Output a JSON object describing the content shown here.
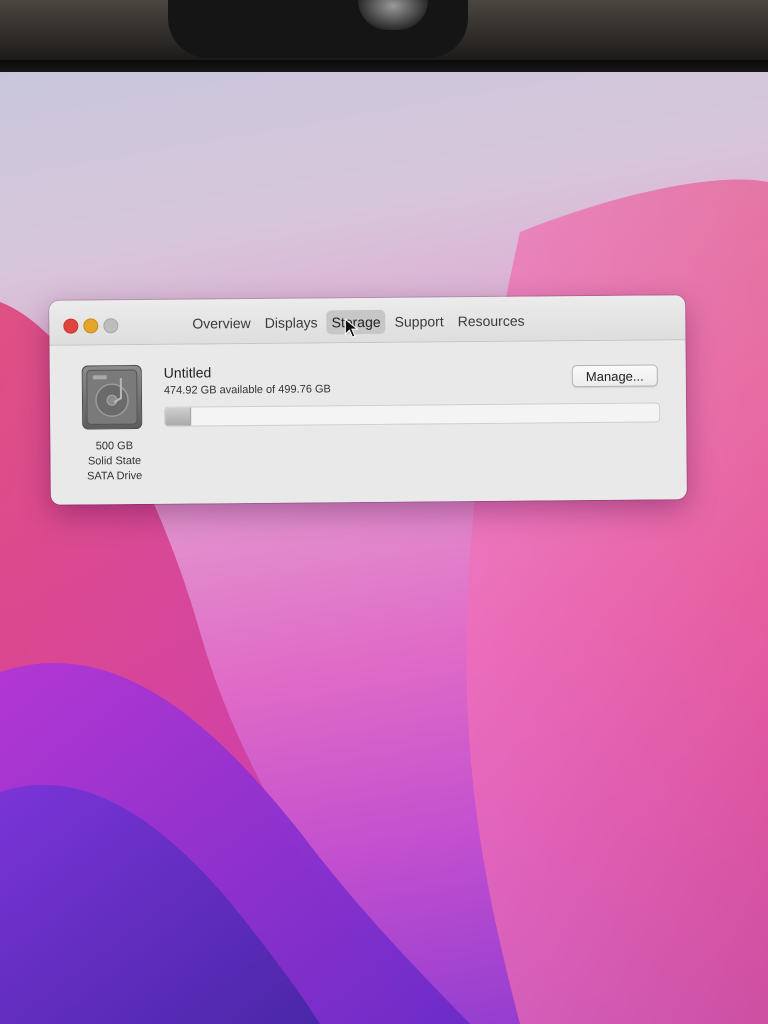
{
  "window": {
    "tabs": [
      {
        "label": "Overview",
        "active": false
      },
      {
        "label": "Displays",
        "active": false
      },
      {
        "label": "Storage",
        "active": true
      },
      {
        "label": "Support",
        "active": false
      },
      {
        "label": "Resources",
        "active": false
      }
    ]
  },
  "storage": {
    "volume_name": "Untitled",
    "available_text": "474.92 GB available of 499.76 GB",
    "available_gb": 474.92,
    "total_gb": 499.76,
    "manage_label": "Manage...",
    "drive_caption": [
      "500 GB",
      "Solid State",
      "SATA Drive"
    ]
  },
  "colors": {
    "close": "#e0443e",
    "minimize": "#e5a52a",
    "zoom_disabled": "#bdbdbd",
    "active_tab": "#c7c7c7"
  },
  "icons": [
    "hard-drive-icon",
    "pointer-cursor-icon"
  ]
}
